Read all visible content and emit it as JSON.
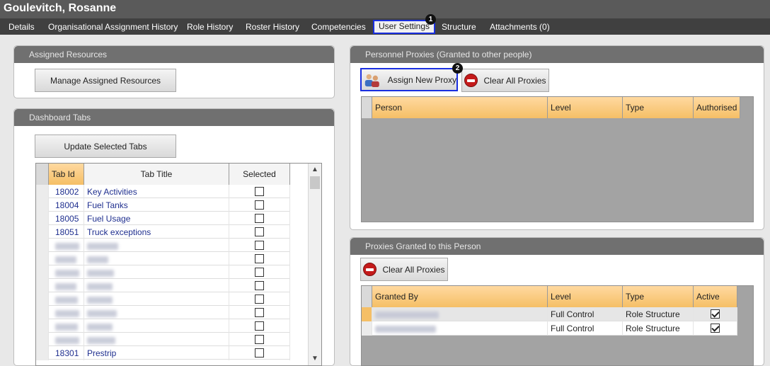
{
  "window": {
    "title": "Goulevitch, Rosanne"
  },
  "tabs": [
    {
      "label": "Details"
    },
    {
      "label": "Organisational Assignment History"
    },
    {
      "label": "Role History"
    },
    {
      "label": "Roster History"
    },
    {
      "label": "Competencies"
    },
    {
      "label": "User Settings"
    },
    {
      "label": "Structure"
    },
    {
      "label": "Attachments (0)"
    }
  ],
  "markers": {
    "one": "1",
    "two": "2"
  },
  "assigned_resources": {
    "title": "Assigned Resources",
    "manage_button": "Manage Assigned Resources"
  },
  "dashboard_tabs": {
    "title": "Dashboard Tabs",
    "update_button": "Update Selected Tabs",
    "columns": {
      "id": "Tab Id",
      "title": "Tab Title",
      "selected": "Selected"
    },
    "rows": [
      {
        "id": "18002",
        "title": "Key Activities",
        "selected": false
      },
      {
        "id": "18004",
        "title": "Fuel Tanks",
        "selected": false
      },
      {
        "id": "18005",
        "title": "Fuel Usage",
        "selected": false
      },
      {
        "id": "18051",
        "title": "Truck exceptions",
        "selected": false
      },
      {
        "id": "",
        "title": "",
        "selected": false
      },
      {
        "id": "",
        "title": "",
        "selected": false
      },
      {
        "id": "",
        "title": "",
        "selected": false
      },
      {
        "id": "",
        "title": "",
        "selected": false
      },
      {
        "id": "",
        "title": "",
        "selected": false
      },
      {
        "id": "",
        "title": "",
        "selected": false
      },
      {
        "id": "",
        "title": "",
        "selected": false
      },
      {
        "id": "",
        "title": "",
        "selected": false
      },
      {
        "id": "18301",
        "title": "Prestrip",
        "selected": false
      }
    ]
  },
  "personnel_proxies": {
    "title": "Personnel Proxies (Granted to other people)",
    "assign_button": "Assign New Proxy",
    "clear_button": "Clear All Proxies",
    "columns": {
      "person": "Person",
      "level": "Level",
      "type": "Type",
      "authorised": "Authorised"
    }
  },
  "proxies_granted": {
    "title": "Proxies Granted to this Person",
    "clear_button": "Clear All Proxies",
    "columns": {
      "granted_by": "Granted By",
      "level": "Level",
      "type": "Type",
      "active": "Active"
    },
    "rows": [
      {
        "granted_by": "",
        "level": "Full Control",
        "type": "Role Structure",
        "active": true
      },
      {
        "granted_by": "",
        "level": "Full Control",
        "type": "Role Structure",
        "active": true
      }
    ]
  }
}
